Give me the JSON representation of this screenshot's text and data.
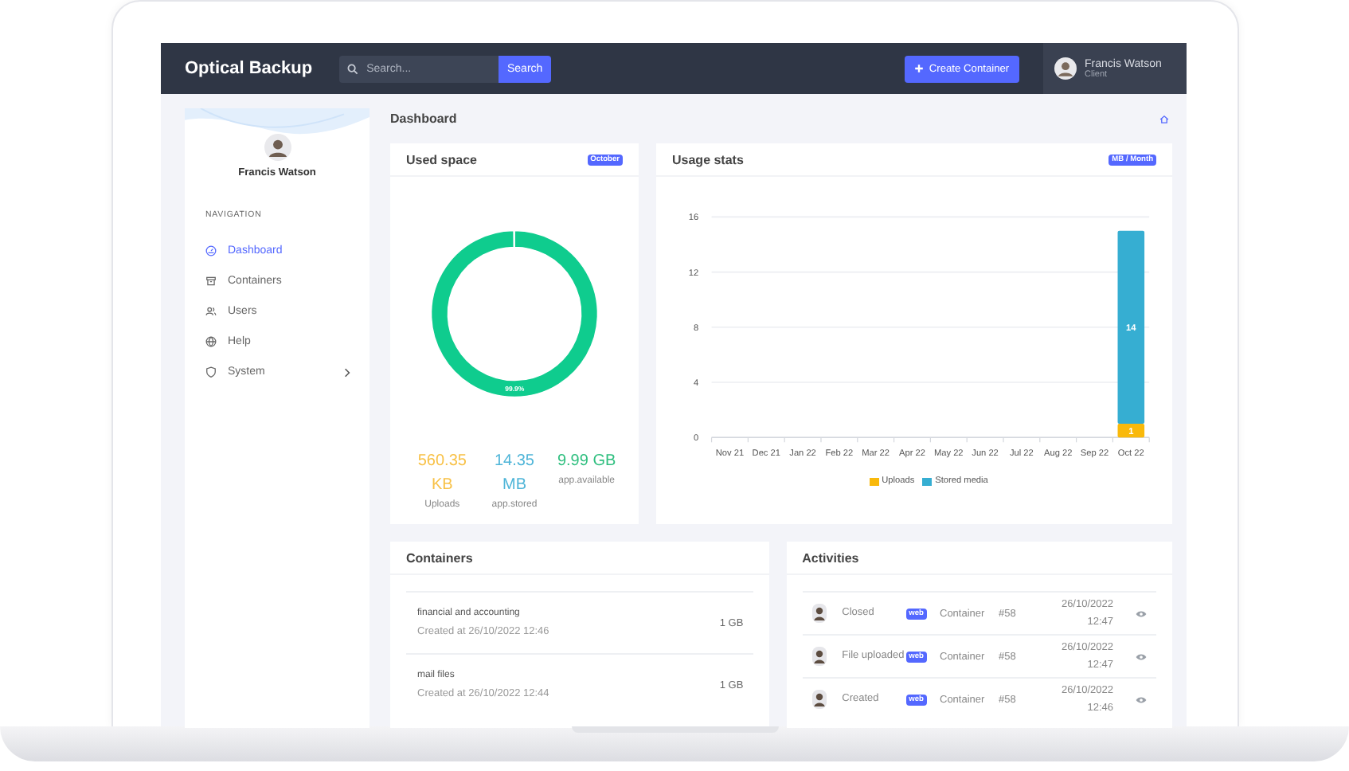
{
  "app": {
    "title": "Optical Backup",
    "search": {
      "placeholder": "Search...",
      "button": "Search"
    },
    "create_button": "Create Container",
    "user": {
      "name": "Francis Watson",
      "role": "Client"
    }
  },
  "sidebar": {
    "user_name": "Francis Watson",
    "section_title": "NAVIGATION",
    "items": [
      {
        "label": "Dashboard",
        "selected": true,
        "has_submenu": false
      },
      {
        "label": "Containers",
        "selected": false,
        "has_submenu": false
      },
      {
        "label": "Users",
        "selected": false,
        "has_submenu": false
      },
      {
        "label": "Help",
        "selected": false,
        "has_submenu": false
      },
      {
        "label": "System",
        "selected": false,
        "has_submenu": true
      }
    ]
  },
  "page_title": "Dashboard",
  "used_space": {
    "title": "Used space",
    "badge": "October",
    "chart_data": {
      "type": "donut",
      "values": [
        99.9,
        0.1
      ],
      "value_labels": [
        "99.9%",
        null
      ]
    },
    "stats": [
      {
        "value": "560.35 KB",
        "label": "Uploads",
        "color": "#f8c146"
      },
      {
        "value": "14.35 MB",
        "label": "app.stored",
        "color": "#4fb5d8"
      },
      {
        "value": "9.99 GB",
        "label": "app.available",
        "color": "#2fbf7f"
      }
    ]
  },
  "usage_stats": {
    "title": "Usage stats",
    "badge": "MB / Month",
    "chart_data": {
      "type": "bar",
      "stacked": true,
      "grid": true,
      "legend": true,
      "data_labels": true,
      "categories": [
        "Nov 21",
        "Dec 21",
        "Jan 22",
        "Feb 22",
        "Mar 22",
        "Apr 22",
        "May 22",
        "Jun 22",
        "Jul 22",
        "Aug 22",
        "Sep 22",
        "Oct 22"
      ],
      "ylim": [
        0,
        16
      ],
      "yticks": [
        0,
        4,
        8,
        12,
        16
      ],
      "series": [
        {
          "name": "Uploads",
          "color": "#f9b90b",
          "values": [
            null,
            null,
            null,
            null,
            null,
            null,
            null,
            null,
            null,
            null,
            null,
            1
          ]
        },
        {
          "name": "Stored media",
          "color": "#36aed2",
          "values": [
            null,
            null,
            null,
            null,
            null,
            null,
            null,
            null,
            null,
            null,
            null,
            14
          ]
        }
      ]
    }
  },
  "containers": {
    "title": "Containers",
    "rows": [
      {
        "name": "financial and accounting",
        "created": "Created at 26/10/2022 12:46",
        "size": "1 GB"
      },
      {
        "name": "mail files",
        "created": "Created at 26/10/2022 12:44",
        "size": "1 GB"
      }
    ]
  },
  "activities": {
    "title": "Activities",
    "rows": [
      {
        "action": "Closed",
        "source": "web",
        "object": "Container",
        "id": "#58",
        "date": "26/10/2022",
        "time": "12:47"
      },
      {
        "action": "File uploaded",
        "source": "web",
        "object": "Container",
        "id": "#58",
        "date": "26/10/2022",
        "time": "12:47"
      },
      {
        "action": "Created",
        "source": "web",
        "object": "Container",
        "id": "#58",
        "date": "26/10/2022",
        "time": "12:46"
      }
    ]
  }
}
